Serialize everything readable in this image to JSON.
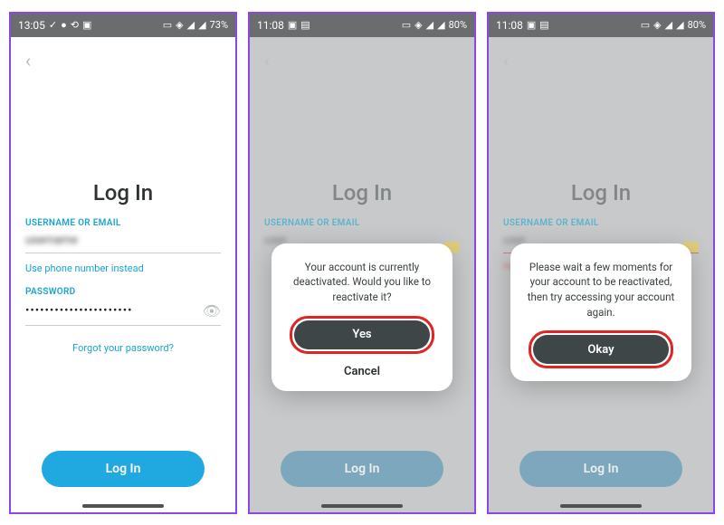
{
  "screens": [
    {
      "status": {
        "time": "13:05",
        "battery": "73%"
      },
      "title": "Log In",
      "labels": {
        "user": "USERNAME OR EMAIL",
        "pass": "PASSWORD"
      },
      "values": {
        "user": "username",
        "pass": "••••••••••••••••••••••"
      },
      "links": {
        "phone": "Use phone number instead",
        "forgot": "Forgot your password?"
      },
      "button": "Log In"
    },
    {
      "status": {
        "time": "11:08",
        "battery": "80%"
      },
      "title": "Log In",
      "labels": {
        "user": "USERNAME OR EMAIL"
      },
      "dialog": {
        "msg": "Your account is currently deactivated. Would you like to reactivate it?",
        "primary": "Yes",
        "secondary": "Cancel"
      },
      "button": "Log In"
    },
    {
      "status": {
        "time": "11:08",
        "battery": "80%"
      },
      "title": "Log In",
      "labels": {
        "user": "USERNAME OR EMAIL"
      },
      "error": "Please try again later",
      "dialog": {
        "msg": "Please wait a few moments for your account to be reactivated, then try accessing your account again.",
        "primary": "Okay"
      },
      "button": "Log In"
    }
  ]
}
